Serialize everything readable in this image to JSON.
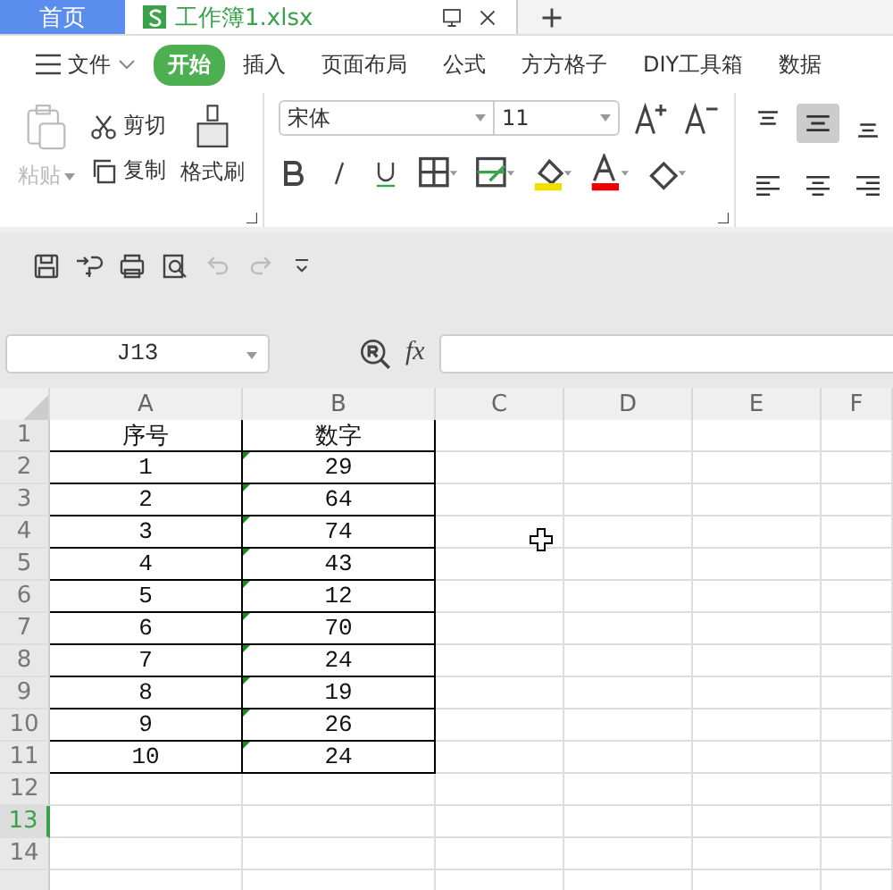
{
  "tabs": [
    {
      "label": "首页",
      "kind": "home",
      "selected": false
    },
    {
      "label": "工作簿1.xlsx",
      "kind": "doc",
      "selected": true
    }
  ],
  "menu": [
    {
      "label": "文件",
      "kind": "file",
      "selected": false
    },
    {
      "label": "开始",
      "kind": "tab",
      "selected": true
    },
    {
      "label": "插入",
      "kind": "tab",
      "selected": false
    },
    {
      "label": "页面布局",
      "kind": "tab",
      "selected": false
    },
    {
      "label": "公式",
      "kind": "tab",
      "selected": false
    },
    {
      "label": "方方格子",
      "kind": "tab",
      "selected": false
    },
    {
      "label": "DIY工具箱",
      "kind": "tab",
      "selected": false
    },
    {
      "label": "数据",
      "kind": "tab",
      "selected": false
    }
  ],
  "clipboard": {
    "paste": {
      "label": "粘贴",
      "disabled": true
    },
    "cut": "剪切",
    "copy": "复制",
    "format_painter": "格式刷"
  },
  "font": {
    "family": "宋体",
    "size": "11"
  },
  "align": [
    {
      "kind": "top",
      "selected": false
    },
    {
      "kind": "middle",
      "selected": true
    },
    {
      "kind": "bottom",
      "selected": false
    },
    {
      "kind": "left",
      "selected": false
    },
    {
      "kind": "center",
      "selected": false
    },
    {
      "kind": "right",
      "selected": false
    }
  ],
  "formula_bar": {
    "name_box": "J13",
    "fx": "fx"
  },
  "columns": [
    "A",
    "B",
    "C",
    "D",
    "E",
    "F"
  ],
  "rows": [
    {
      "number": "1",
      "selected": false,
      "cells": [
        {
          "value": "序号",
          "flag": false
        },
        {
          "value": "数字",
          "flag": false
        }
      ]
    },
    {
      "number": "2",
      "selected": false,
      "cells": [
        {
          "value": "1",
          "flag": false
        },
        {
          "value": "29",
          "flag": true
        }
      ]
    },
    {
      "number": "3",
      "selected": false,
      "cells": [
        {
          "value": "2",
          "flag": false
        },
        {
          "value": "64",
          "flag": true
        }
      ]
    },
    {
      "number": "4",
      "selected": false,
      "cells": [
        {
          "value": "3",
          "flag": false
        },
        {
          "value": "74",
          "flag": true
        }
      ]
    },
    {
      "number": "5",
      "selected": false,
      "cells": [
        {
          "value": "4",
          "flag": false
        },
        {
          "value": "43",
          "flag": true
        }
      ]
    },
    {
      "number": "6",
      "selected": false,
      "cells": [
        {
          "value": "5",
          "flag": false
        },
        {
          "value": "12",
          "flag": true
        }
      ]
    },
    {
      "number": "7",
      "selected": false,
      "cells": [
        {
          "value": "6",
          "flag": false
        },
        {
          "value": "70",
          "flag": true
        }
      ]
    },
    {
      "number": "8",
      "selected": false,
      "cells": [
        {
          "value": "7",
          "flag": false
        },
        {
          "value": "24",
          "flag": true
        }
      ]
    },
    {
      "number": "9",
      "selected": false,
      "cells": [
        {
          "value": "8",
          "flag": false
        },
        {
          "value": "19",
          "flag": true
        }
      ]
    },
    {
      "number": "10",
      "selected": false,
      "cells": [
        {
          "value": "9",
          "flag": false
        },
        {
          "value": "26",
          "flag": true
        }
      ]
    },
    {
      "number": "11",
      "selected": false,
      "cells": [
        {
          "value": "10",
          "flag": false
        },
        {
          "value": "24",
          "flag": true
        }
      ]
    },
    {
      "number": "12",
      "selected": false,
      "cells": []
    },
    {
      "number": "13",
      "selected": true,
      "cells": []
    },
    {
      "number": "14",
      "selected": false,
      "cells": []
    }
  ]
}
